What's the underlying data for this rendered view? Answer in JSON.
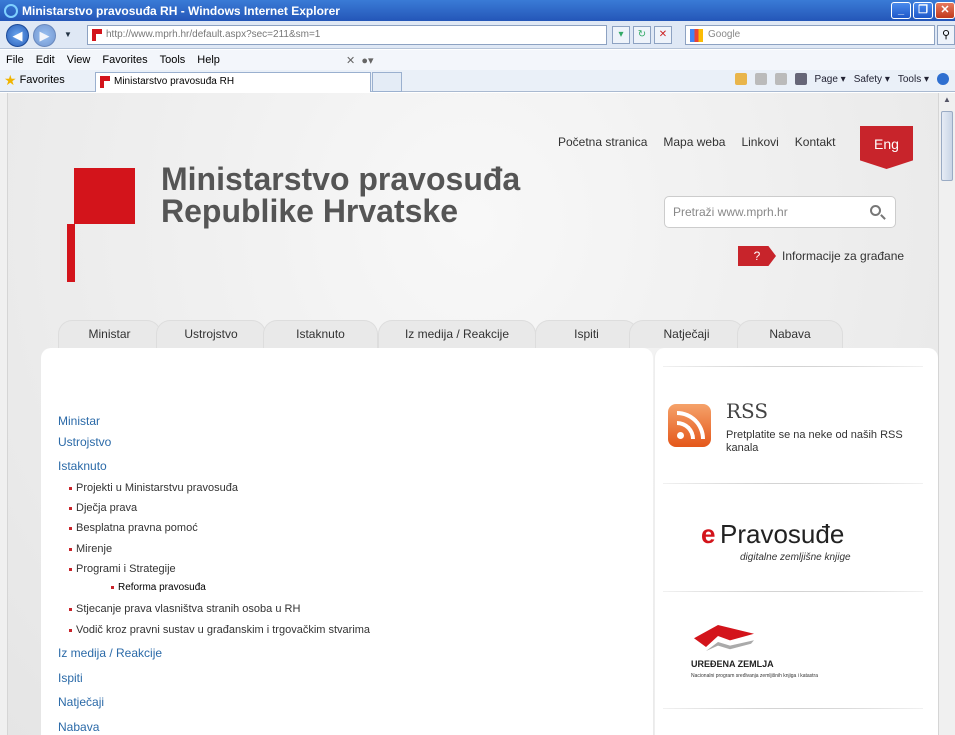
{
  "browser": {
    "window_title": "Ministarstvo pravosuđa RH - Windows Internet Explorer",
    "address": "http://www.mprh.hr/default.aspx?sec=211&sm=1",
    "search_placeholder": "Google",
    "menu": [
      "File",
      "Edit",
      "View",
      "Favorites",
      "Tools",
      "Help"
    ],
    "favorites_label": "Favorites",
    "tab_title": "Ministarstvo pravosuđa RH",
    "command_bar": [
      "Page ▾",
      "Safety ▾",
      "Tools ▾"
    ]
  },
  "site": {
    "top_links": [
      "Početna stranica",
      "Mapa weba",
      "Linkovi",
      "Kontakt"
    ],
    "lang_button": "Eng",
    "title_line1": "Ministarstvo pravosuđa",
    "title_line2": "Republike Hrvatske",
    "search_placeholder": "Pretraži www.mprh.hr",
    "info_badge": "?",
    "info_label": "Informacije za građane",
    "nav_tabs": [
      "Ministar",
      "Ustrojstvo",
      "Istaknuto",
      "Iz medija / Reakcije",
      "Ispiti",
      "Natječaji",
      "Nabava"
    ],
    "left_menu": {
      "ministar": "Ministar",
      "ustrojstvo": "Ustrojstvo",
      "istaknuto": "Istaknuto",
      "sub": [
        "Projekti u Ministarstvu pravosuđa",
        "Dječja prava",
        "Besplatna pravna pomoć",
        "Mirenje",
        "Programi i Strategije",
        "Reforma pravosuđa",
        "Stjecanje prava vlasništva stranih osoba u RH",
        "Vodič kroz pravni sustav u građanskim i trgovačkim stvarima"
      ],
      "iz_medija": "Iz medija / Reakcije",
      "ispiti": "Ispiti",
      "natjecaji": "Natječaji",
      "nabava": "Nabava"
    },
    "rss": {
      "title": "RSS",
      "text": "Pretplatite se na neke od naših RSS kanala"
    },
    "epravosudje": {
      "title": "Pravosuđe",
      "subtitle": "digitalne zemljišne knjige"
    },
    "uredjena_zemlja": {
      "title": "UREĐENA ZEMLJA",
      "subtitle": "Nacionalni program sređivanja zemljišnih knjiga i katastra"
    }
  }
}
